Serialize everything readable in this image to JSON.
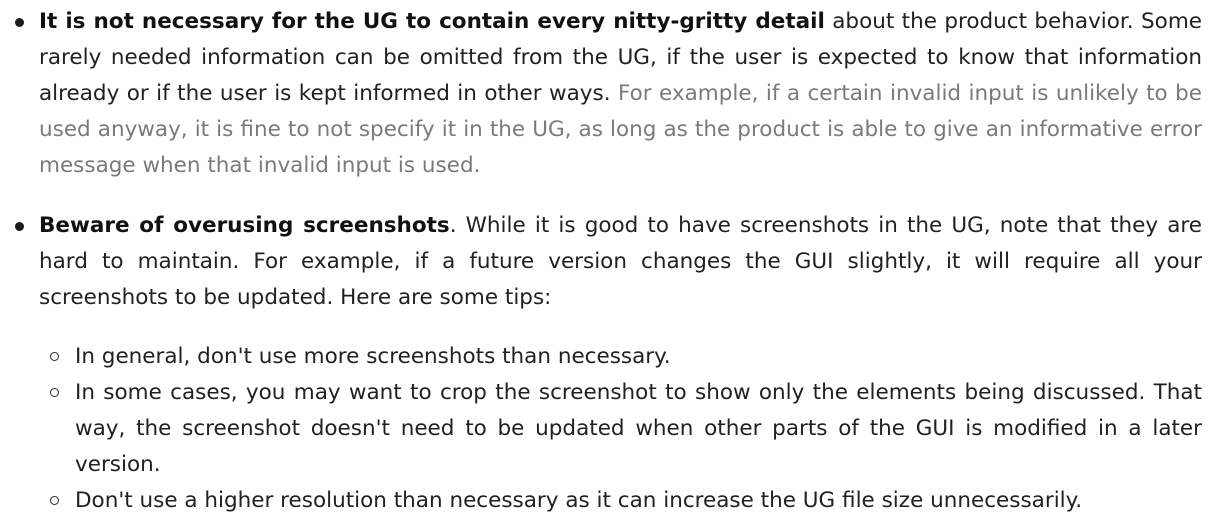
{
  "items": [
    {
      "bold": "It is not necessary for the UG to contain every nitty-gritty detail",
      "text": " about the product behavior. Some rarely needed information can be omitted from the UG, if the user is expected to know that information already or if the user is kept informed in other ways.",
      "muted": " For example, if a certain invalid input is unlikely to be used anyway, it is fine to not specify it in the UG, as long as the product is able to give an informative error message when that invalid input is used."
    },
    {
      "bold": "Beware of overusing screenshots",
      "text": ". While it is good to have screenshots in the UG, note that they are hard to maintain. For example, if a future version changes the GUI slightly, it will require all your screenshots to be updated. Here are some tips:",
      "tips": [
        "In general, don't use more screenshots than necessary.",
        "In some cases, you may want to crop the screenshot to show only the elements being discussed. That way, the screenshot doesn't need to be updated when other parts of the GUI is modified in a later version.",
        "Don't use a higher resolution than necessary as it can increase the UG file size unnecessarily."
      ]
    }
  ]
}
